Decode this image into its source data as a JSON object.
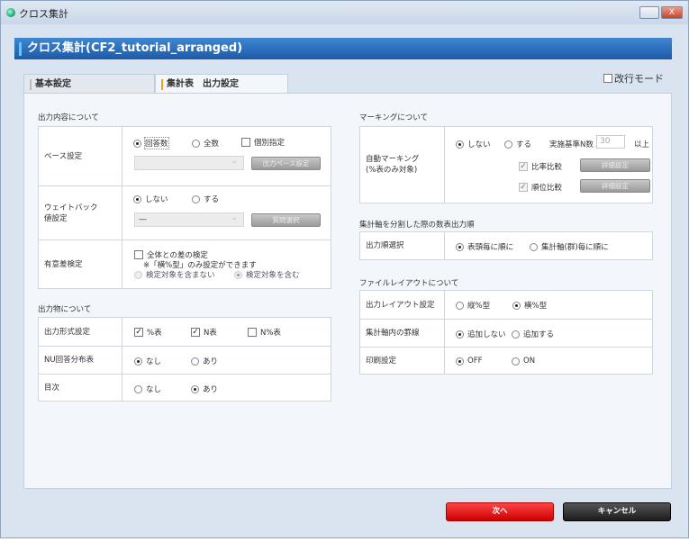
{
  "window": {
    "title": "クロス集計",
    "close_label": "X"
  },
  "header": {
    "title": "クロス集計(CF2_tutorial_arranged)"
  },
  "tabs": [
    {
      "label": "基本設定",
      "active": false
    },
    {
      "label": "集計表　出力設定",
      "active": true
    }
  ],
  "kaigyo_mode": {
    "label": "改行モード",
    "checked": false
  },
  "output_content": {
    "title": "出力内容について",
    "base": {
      "label": "ベース設定",
      "options": [
        "回答数",
        "全数"
      ],
      "selected": "回答数",
      "individual_label": "個別指定",
      "individual_checked": false,
      "select_value": "",
      "button": "出力ベース設定"
    },
    "weightback": {
      "label": "ウェイトバック\n値設定",
      "options": [
        "しない",
        "する"
      ],
      "selected": "しない",
      "select_value": "—",
      "button": "質問選択"
    },
    "significance": {
      "label": "有意差検定",
      "check_label": "全体との差の検定",
      "checked": false,
      "note": "※「横%型」のみ設定ができます",
      "options": [
        "検定対象を含まない",
        "検定対象を含む"
      ],
      "selected": "検定対象を含む"
    }
  },
  "output_items": {
    "title": "出力物について",
    "format": {
      "label": "出力形式設定",
      "checks": [
        {
          "label": "%表",
          "checked": true
        },
        {
          "label": "N表",
          "checked": true
        },
        {
          "label": "N%表",
          "checked": false
        }
      ]
    },
    "nu": {
      "label": "NU回答分布表",
      "options": [
        "なし",
        "あり"
      ],
      "selected": "なし"
    },
    "toc": {
      "label": "目次",
      "options": [
        "なし",
        "あり"
      ],
      "selected": "あり"
    }
  },
  "marking": {
    "title": "マーキングについて",
    "auto": {
      "label": "自動マーキング\n(%表のみ対象)",
      "options": [
        "しない",
        "する"
      ],
      "selected": "しない",
      "n_label": "実施基準N数",
      "n_value": "30",
      "n_suffix": "以上",
      "ratio": {
        "label": "比率比較",
        "checked": true,
        "button": "詳細設定"
      },
      "rank": {
        "label": "順位比較",
        "checked": true,
        "button": "詳細設定"
      }
    }
  },
  "order": {
    "title": "集計軸を分割した際の数表出力順",
    "label": "出力順選択",
    "options": [
      "表頭毎に順に",
      "集計軸(群)毎に順に"
    ],
    "selected": "表頭毎に順に"
  },
  "layout": {
    "title": "ファイルレイアウトについて",
    "layout_setting": {
      "label": "出力レイアウト設定",
      "options": [
        "縦%型",
        "横%型"
      ],
      "selected": "横%型"
    },
    "lines": {
      "label": "集計軸内の罫線",
      "options": [
        "追加しない",
        "追加する"
      ],
      "selected": "追加しない"
    },
    "print": {
      "label": "印刷設定",
      "options": [
        "OFF",
        "ON"
      ],
      "selected": "OFF"
    }
  },
  "footer": {
    "next": "次へ",
    "cancel": "キャンセル"
  }
}
